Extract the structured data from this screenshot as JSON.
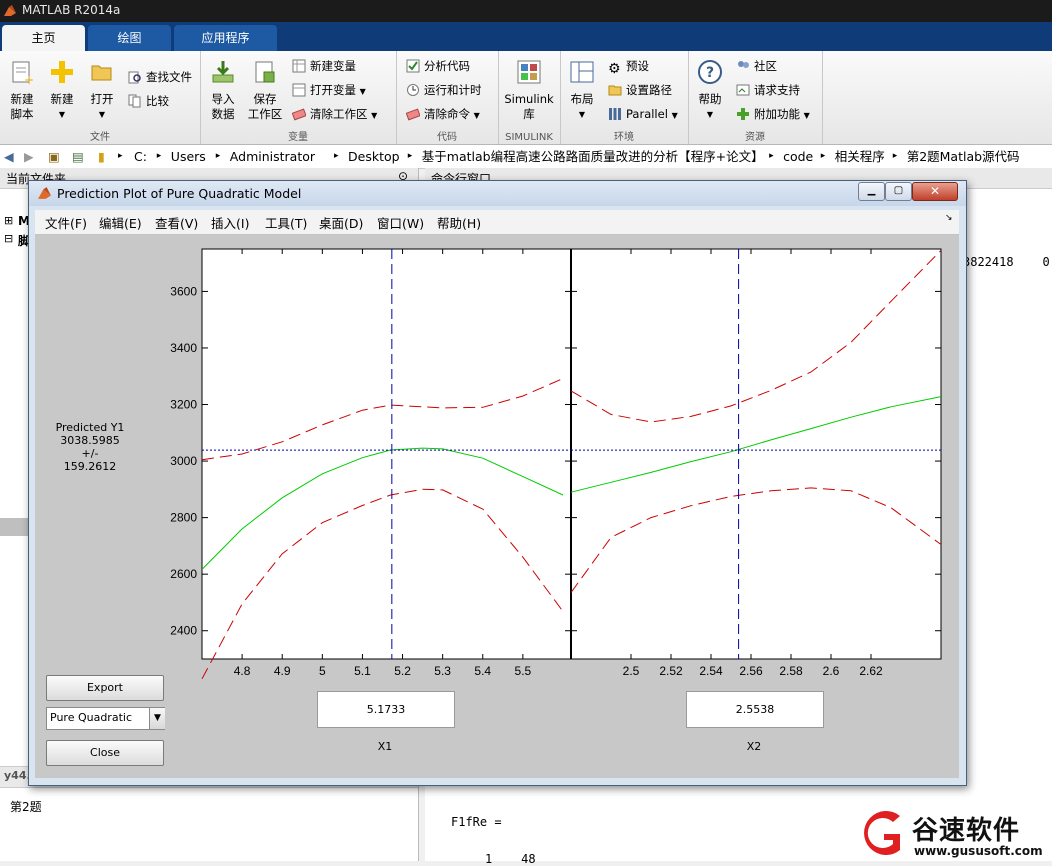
{
  "app": {
    "title": "MATLAB R2014a"
  },
  "ribbon": {
    "tabs": [
      "主页",
      "绘图",
      "应用程序"
    ],
    "groups": {
      "file": {
        "label": "文件",
        "new_script": "新建\n脚本",
        "new": "新建",
        "open": "打开",
        "find_files": "查找文件",
        "compare": "比较"
      },
      "variable": {
        "label": "变量",
        "import_data": "导入\n数据",
        "save_workspace": "保存\n工作区",
        "new_variable": "新建变量",
        "open_variable": "打开变量",
        "clear_workspace": "清除工作区"
      },
      "code": {
        "label": "代码",
        "analyze_code": "分析代码",
        "run_and_time": "运行和计时",
        "clear_commands": "清除命令"
      },
      "simulink": {
        "label": "SIMULINK",
        "simulink_library": "Simulink\n库"
      },
      "environment": {
        "label": "环境",
        "layout": "布局",
        "preferences": "预设",
        "set_path": "设置路径",
        "parallel": "Parallel"
      },
      "resources": {
        "label": "资源",
        "help": "帮助",
        "community": "社区",
        "request_support": "请求支持",
        "addons": "附加功能"
      }
    }
  },
  "address_bar": {
    "path": [
      "C:",
      "Users",
      "Administrator",
      "Desktop",
      "基于matlab编程高速公路路面质量改进的分析【程序+论文】",
      "code",
      "相关程序",
      "第2题Matlab源代码"
    ]
  },
  "left_panel": {
    "title": "当前文件夹",
    "tree_items": [
      "M",
      "脚"
    ],
    "file_label": "y44.m",
    "detail_text": "第2题"
  },
  "command_window": {
    "title": "命令行窗口",
    "line1": "3822418    0.0",
    "line2": "F1fRe =",
    "line3": "1    48"
  },
  "figure": {
    "title": "Prediction Plot of Pure Quadratic Model",
    "menu": [
      "文件(F)",
      "编辑(E)",
      "查看(V)",
      "插入(I)",
      "工具(T)",
      "桌面(D)",
      "窗口(W)",
      "帮助(H)"
    ],
    "prediction": {
      "label": "Predicted Y1",
      "value": "3038.5985",
      "pm": "+/-",
      "ci": "159.2612"
    },
    "export_label": "Export",
    "model_select": "Pure Quadratic",
    "close_label": "Close",
    "x1_value": "5.1733",
    "x1_label": "X1",
    "x2_value": "2.5538",
    "x2_label": "X2"
  },
  "watermark": {
    "brand": "谷速软件",
    "url": "www.gususoft.com"
  },
  "chart_data": {
    "type": "line",
    "ylim": [
      2300,
      3750
    ],
    "yticks": [
      2400,
      2600,
      2800,
      3000,
      3200,
      3400,
      3600
    ],
    "horizontal_ref": 3038.6,
    "colors": {
      "fit": "#00cc00",
      "ci": "#cc0000",
      "ref": "#0000aa"
    },
    "panels": [
      {
        "variable": "X1",
        "xlim": [
          4.7,
          5.62
        ],
        "xticks": [
          "4.8",
          "4.9",
          "5",
          "5.1",
          "5.2",
          "5.3",
          "5.4",
          "5.5"
        ],
        "current_x": 5.1733,
        "x": [
          4.7,
          4.8,
          4.9,
          5.0,
          5.1,
          5.17,
          5.25,
          5.3,
          5.4,
          5.5,
          5.6
        ],
        "fit": [
          2617,
          2760,
          2870,
          2955,
          3012,
          3039,
          3046,
          3043,
          3010,
          2945,
          2880
        ],
        "upper": [
          3005,
          3025,
          3068,
          3128,
          3180,
          3198,
          3192,
          3188,
          3190,
          3230,
          3292
        ],
        "lower": [
          2230,
          2495,
          2672,
          2782,
          2843,
          2880,
          2900,
          2898,
          2830,
          2660,
          2468
        ]
      },
      {
        "variable": "X2",
        "xlim": [
          2.47,
          2.655
        ],
        "xticks": [
          "2.5",
          "2.52",
          "2.54",
          "2.56",
          "2.58",
          "2.6",
          "2.62"
        ],
        "current_x": 2.5538,
        "x": [
          2.47,
          2.49,
          2.51,
          2.53,
          2.55,
          2.57,
          2.59,
          2.61,
          2.63,
          2.655
        ],
        "fit": [
          2890,
          2925,
          2960,
          2998,
          3033,
          3075,
          3115,
          3155,
          3192,
          3228
        ],
        "upper": [
          3248,
          3165,
          3138,
          3158,
          3195,
          3250,
          3315,
          3420,
          3565,
          3745
        ],
        "lower": [
          2535,
          2730,
          2800,
          2842,
          2875,
          2895,
          2905,
          2895,
          2835,
          2705
        ]
      }
    ]
  }
}
